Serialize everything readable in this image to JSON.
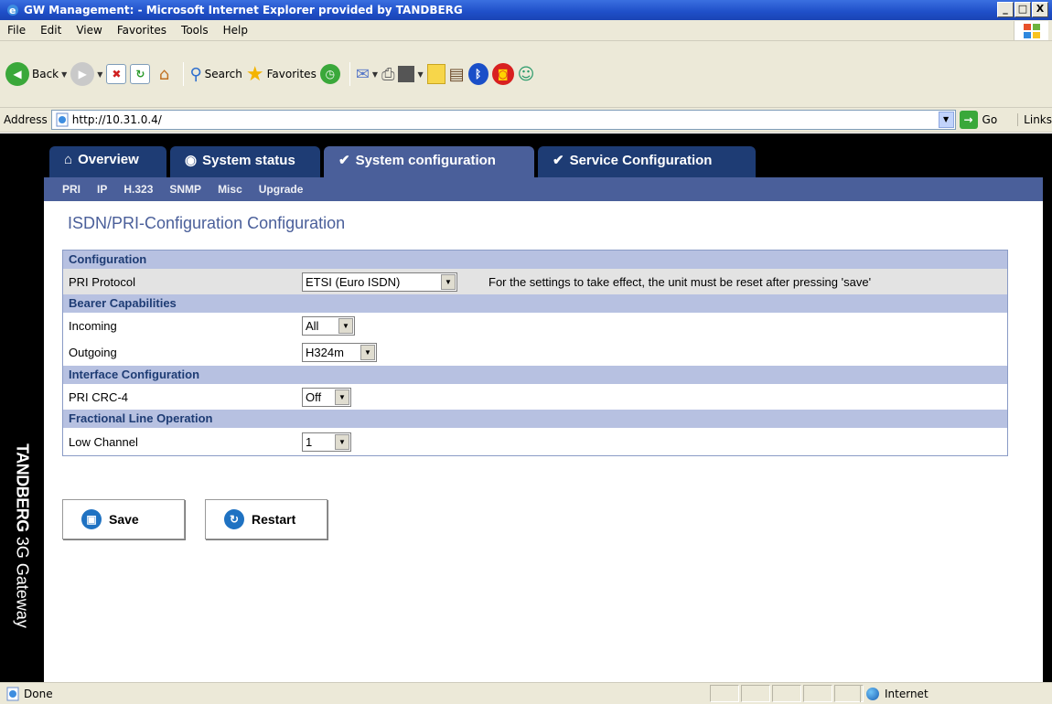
{
  "window": {
    "title": "GW Management: - Microsoft Internet Explorer provided by TANDBERG",
    "minimize": "_",
    "maximize": "□",
    "close": "X"
  },
  "menubar": {
    "items": [
      "File",
      "Edit",
      "View",
      "Favorites",
      "Tools",
      "Help"
    ]
  },
  "toolbar": {
    "back": "Back",
    "search": "Search",
    "favorites": "Favorites"
  },
  "address": {
    "label": "Address",
    "url": "http://10.31.0.4/",
    "go": "Go",
    "links": "Links"
  },
  "brand": {
    "bold": "TANDBERG",
    "rest": " 3G Gateway"
  },
  "tabs": [
    {
      "label": "Overview",
      "icon": "⌂"
    },
    {
      "label": "System status",
      "icon": "◉"
    },
    {
      "label": "System configuration",
      "icon": "✔"
    },
    {
      "label": "Service Configuration",
      "icon": "✔"
    }
  ],
  "subnav": [
    "PRI",
    "IP",
    "H.323",
    "SNMP",
    "Misc",
    "Upgrade"
  ],
  "page": {
    "heading": "ISDN/PRI-Configuration Configuration"
  },
  "config": {
    "sections": {
      "configuration": "Configuration",
      "bearer": "Bearer Capabilities",
      "interface": "Interface Configuration",
      "fractional": "Fractional Line Operation"
    },
    "pri_protocol": {
      "label": "PRI Protocol",
      "value": "ETSI (Euro ISDN)",
      "note": "For the settings to take effect, the unit must be reset after pressing 'save'"
    },
    "incoming": {
      "label": "Incoming",
      "value": "All"
    },
    "outgoing": {
      "label": "Outgoing",
      "value": "H324m"
    },
    "crc4": {
      "label": "PRI CRC-4",
      "value": "Off"
    },
    "low_channel": {
      "label": "Low Channel",
      "value": "1"
    }
  },
  "buttons": {
    "save": "Save",
    "restart": "Restart"
  },
  "status": {
    "text": "Done",
    "zone": "Internet"
  }
}
